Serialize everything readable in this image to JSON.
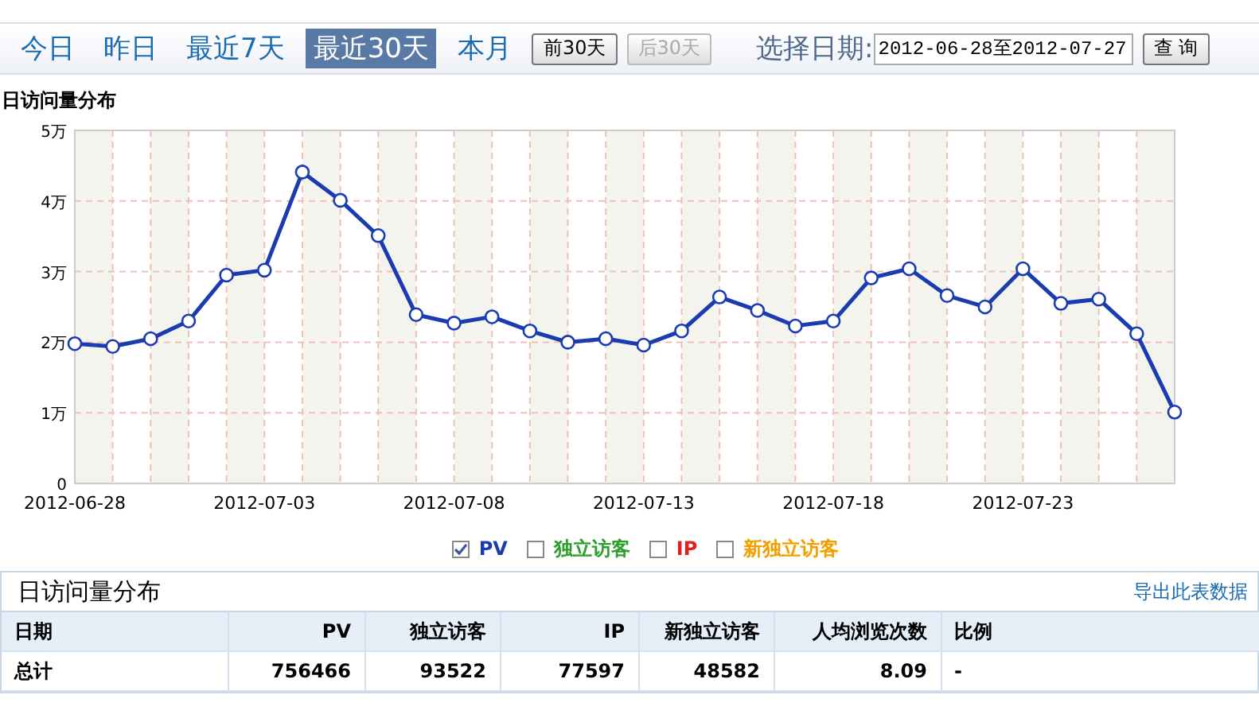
{
  "range_bar": {
    "quick_ranges": [
      {
        "label": "今日",
        "selected": false
      },
      {
        "label": "昨日",
        "selected": false
      },
      {
        "label": "最近7天",
        "selected": false
      },
      {
        "label": "最近30天",
        "selected": true
      },
      {
        "label": "本月",
        "selected": false
      }
    ],
    "page_buttons": [
      {
        "label": "前30天",
        "disabled": false
      },
      {
        "label": "后30天",
        "disabled": true
      }
    ],
    "date_label": "选择日期:",
    "date_value": "2012-06-28至2012-07-27",
    "query_button": "查 询"
  },
  "chart_title": "日访问量分布",
  "chart": {
    "chart_data": {
      "type": "line",
      "categories": [
        "2012-06-28",
        null,
        null,
        null,
        null,
        "2012-07-03",
        null,
        null,
        null,
        null,
        "2012-07-08",
        null,
        null,
        null,
        null,
        "2012-07-13",
        null,
        null,
        null,
        null,
        "2012-07-18",
        null,
        null,
        null,
        null,
        "2012-07-23",
        null,
        null,
        null,
        null
      ],
      "yticks": [
        {
          "value": 0,
          "label": "0"
        },
        {
          "value": 1,
          "label": "1万"
        },
        {
          "value": 2,
          "label": "2万"
        },
        {
          "value": 3,
          "label": "3万"
        },
        {
          "value": 4,
          "label": "4万"
        },
        {
          "value": 5,
          "label": "5万"
        }
      ],
      "ylim": [
        0,
        5
      ],
      "grid": true,
      "series": [
        {
          "color": "#1a3cb0",
          "marker": "circle",
          "values": [
            1.98,
            1.94,
            2.05,
            2.3,
            2.95,
            3.02,
            4.41,
            4.01,
            3.51,
            2.39,
            2.27,
            2.36,
            2.16,
            2.0,
            2.05,
            1.96,
            2.16,
            2.64,
            2.45,
            2.23,
            2.3,
            2.91,
            3.04,
            2.66,
            2.5,
            3.04,
            2.55,
            2.61,
            2.12,
            1.01
          ]
        }
      ]
    }
  },
  "legend": [
    {
      "label": "PV",
      "color": "#1a3cb0",
      "checked": true
    },
    {
      "label": "独立访客",
      "color": "#2ca02c",
      "checked": false
    },
    {
      "label": "IP",
      "color": "#e02020",
      "checked": false
    },
    {
      "label": "新独立访客",
      "color": "#f0a000",
      "checked": false
    }
  ],
  "table": {
    "title": "日访问量分布",
    "export_link": "导出此表数据",
    "columns": [
      {
        "label": "日期",
        "kind": "text"
      },
      {
        "label": "PV",
        "kind": "number"
      },
      {
        "label": "独立访客",
        "kind": "number"
      },
      {
        "label": "IP",
        "kind": "number"
      },
      {
        "label": "新独立访客",
        "kind": "number"
      },
      {
        "label": "人均浏览次数",
        "kind": "number"
      },
      {
        "label": "比例",
        "kind": "text"
      }
    ],
    "rows": [
      [
        "总计",
        "756466",
        "93522",
        "77597",
        "48582",
        "8.09",
        "-"
      ]
    ]
  }
}
